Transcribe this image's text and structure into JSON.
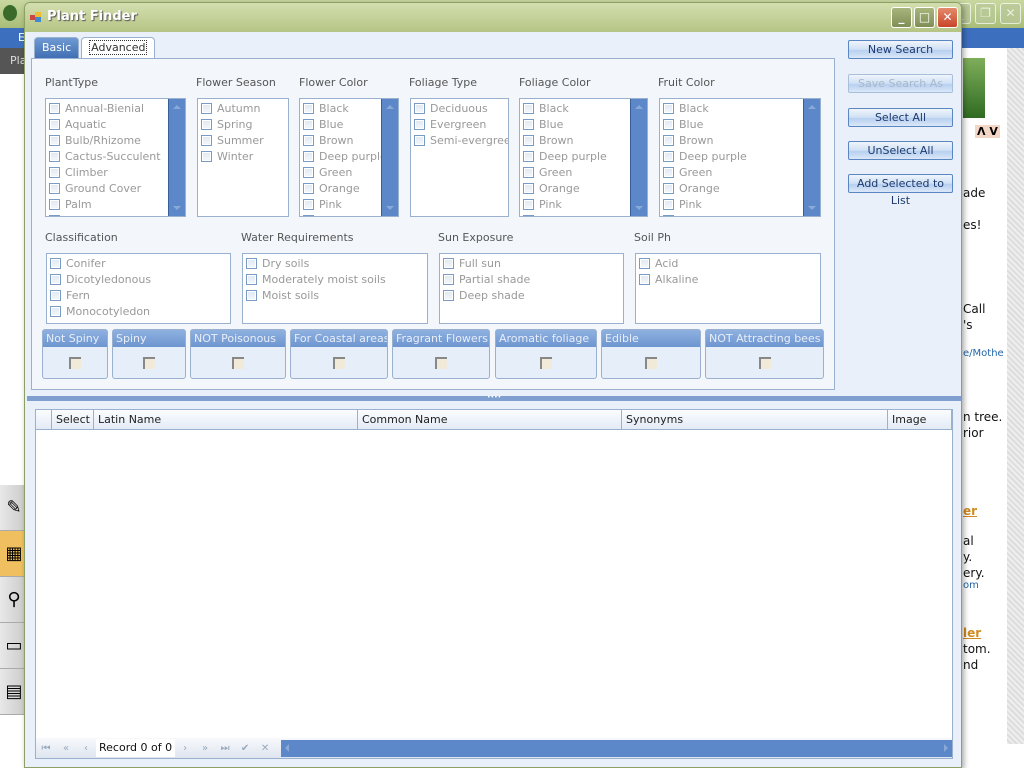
{
  "background": {
    "menu_hint": "E",
    "toolbar_hint": "Pla",
    "right_texts": [
      "ade",
      "es!",
      "Call",
      "'s",
      "n tree.",
      "rior",
      "al",
      "y.",
      "ery.",
      "tom.",
      "nd"
    ],
    "right_links": [
      "e/Mothe",
      "om"
    ],
    "right_orange": [
      "er",
      "ler"
    ],
    "arrows": "Λ V"
  },
  "window": {
    "title": "Plant Finder",
    "minimize": "_",
    "maximize": "□",
    "close": "✕"
  },
  "tabs": [
    {
      "label": "Basic",
      "active": false
    },
    {
      "label": "Advanced",
      "active": true
    }
  ],
  "groups": {
    "plant_type": {
      "label": "PlantType",
      "items": [
        "Annual-Bienial",
        "Aquatic",
        "Bulb/Rhizome",
        "Cactus-Succulent",
        "Climber",
        "Ground Cover",
        "Palm",
        "Perennial"
      ]
    },
    "flower_season": {
      "label": "Flower Season",
      "items": [
        "Autumn",
        "Spring",
        "Summer",
        "Winter"
      ]
    },
    "flower_color": {
      "label": "Flower Color",
      "items": [
        "Black",
        "Blue",
        "Brown",
        "Deep purple",
        "Green",
        "Orange",
        "Pink",
        "Purple"
      ]
    },
    "foliage_type": {
      "label": "Foliage Type",
      "items": [
        "Deciduous",
        "Evergreen",
        "Semi-evergreen"
      ]
    },
    "foliage_color": {
      "label": "Foliage Color",
      "items": [
        "Black",
        "Blue",
        "Brown",
        "Deep purple",
        "Green",
        "Orange",
        "Pink",
        "Purple"
      ]
    },
    "fruit_color": {
      "label": "Fruit Color",
      "items": [
        "Black",
        "Blue",
        "Brown",
        "Deep purple",
        "Green",
        "Orange",
        "Pink",
        "Purple"
      ]
    },
    "classification": {
      "label": "Classification",
      "items": [
        "Conifer",
        "Dicotyledonous",
        "Fern",
        "Monocotyledon"
      ]
    },
    "water": {
      "label": "Water Requirements",
      "items": [
        "Dry soils",
        "Moderately moist soils",
        "Moist soils"
      ]
    },
    "sun": {
      "label": "Sun Exposure",
      "items": [
        "Full sun",
        "Partial shade",
        "Deep shade"
      ]
    },
    "soil": {
      "label": "Soil Ph",
      "items": [
        "Acid",
        "Alkaline"
      ]
    }
  },
  "flags": [
    {
      "label": "Not Spiny",
      "checked": false
    },
    {
      "label": "Spiny",
      "checked": false
    },
    {
      "label": "NOT Poisonous",
      "checked": false
    },
    {
      "label": "For Coastal areas",
      "checked": false
    },
    {
      "label": "Fragrant Flowers",
      "checked": false
    },
    {
      "label": "Aromatic foliage",
      "checked": false
    },
    {
      "label": "Edible",
      "checked": false
    },
    {
      "label": "NOT Attracting bees",
      "checked": false
    }
  ],
  "buttons": {
    "new_search": "New Search",
    "save_search_as": "Save Search As",
    "select_all": "Select All",
    "unselect_all": "UnSelect All",
    "add_selected": "Add Selected to List"
  },
  "grid": {
    "columns": [
      "",
      "Select",
      "Latin Name",
      "Common Name",
      "Synonyms",
      "Image"
    ],
    "rows": []
  },
  "navigator": {
    "record_text": "Record 0 of 0",
    "first": "⏮",
    "prev_page": "«",
    "prev": "‹",
    "next": "›",
    "next_page": "»",
    "last": "⏭",
    "apply": "✔",
    "cancel": "✕"
  }
}
